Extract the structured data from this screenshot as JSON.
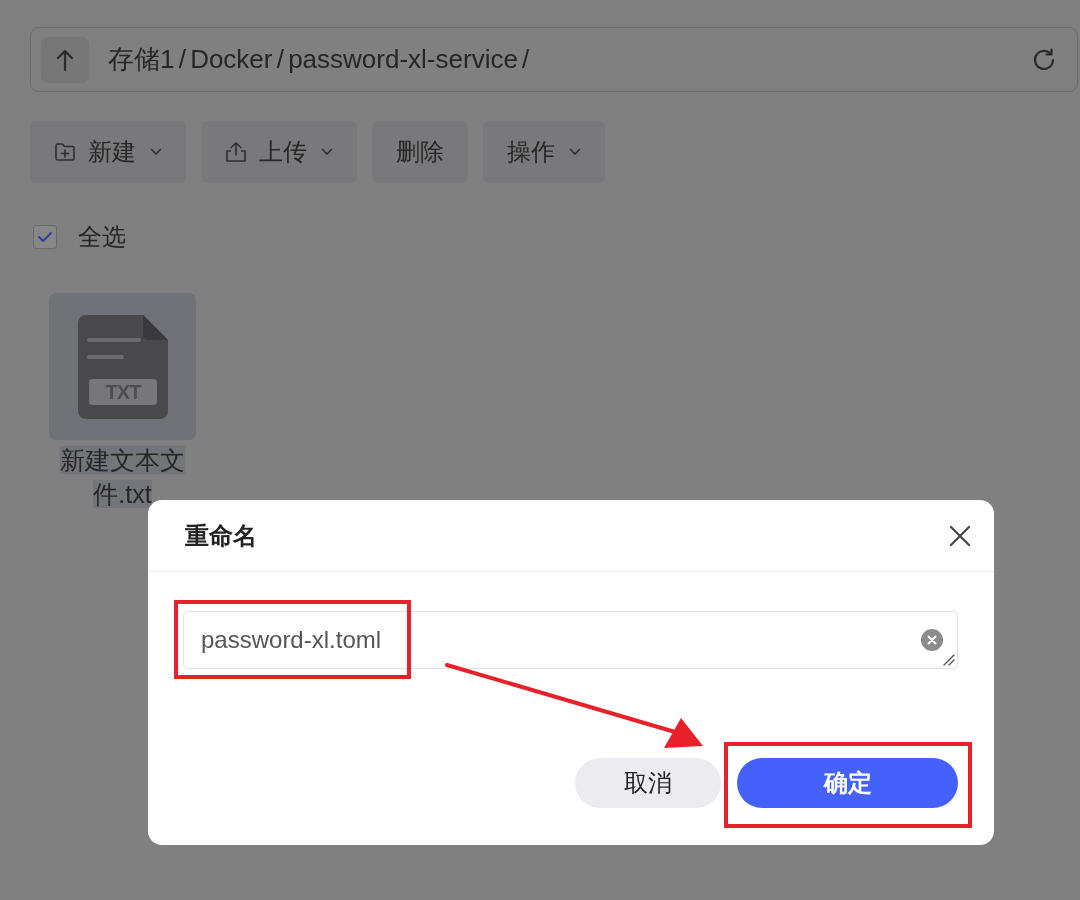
{
  "path_bar": {
    "path": "存储1 / Docker / password-xl-service /"
  },
  "toolbar": [
    {
      "label": "新建",
      "kind": "create",
      "dropdown": true
    },
    {
      "label": "上传",
      "kind": "upload",
      "dropdown": true
    },
    {
      "label": "删除",
      "kind": "plain",
      "dropdown": false
    },
    {
      "label": "操作",
      "kind": "plain",
      "dropdown": true
    }
  ],
  "select_all": {
    "label": "全选",
    "checked": true
  },
  "files": [
    {
      "name": "新建文本文件.txt",
      "badge": "TXT",
      "selected": true
    }
  ],
  "dialog": {
    "title": "重命名",
    "input": {
      "value": "password-xl.toml",
      "highlighted": true
    },
    "annotation_arrow": true,
    "buttons": [
      {
        "label": "取消",
        "kind": "secondary",
        "highlighted": false
      },
      {
        "label": "确定",
        "kind": "primary",
        "highlighted": true
      }
    ]
  }
}
